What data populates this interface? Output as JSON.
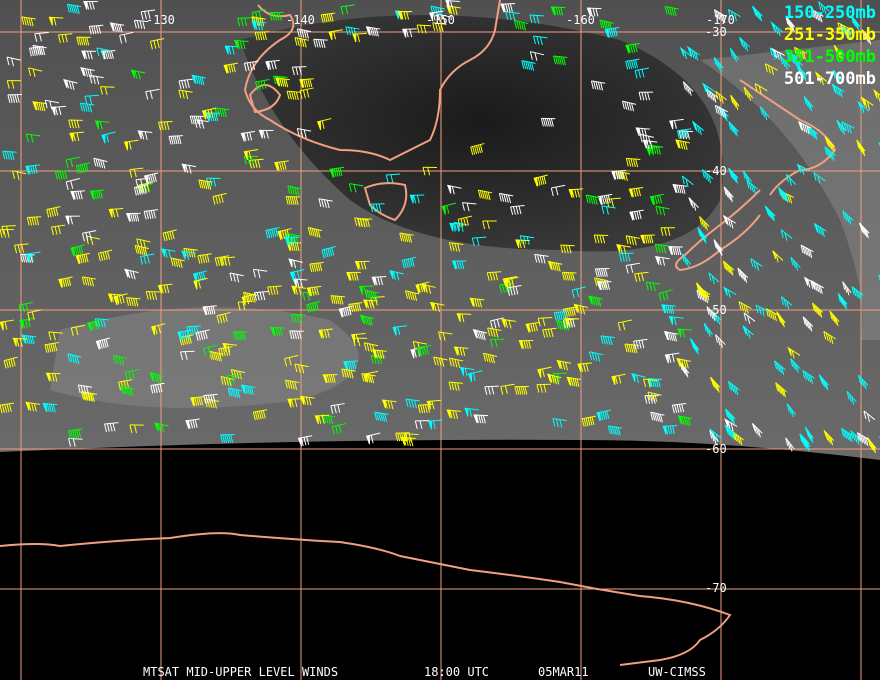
{
  "map": {
    "lon_labels": [
      "-130",
      "-140",
      "-150",
      "-160",
      "-170"
    ],
    "lat_labels": [
      "-30",
      "-40",
      "-50",
      "-60",
      "-70"
    ],
    "grid_color": "#f0a080",
    "coast_color": "#f0a080"
  },
  "legend": [
    {
      "label": "150-250mb",
      "color": "#00ffff"
    },
    {
      "label": "251-350mb",
      "color": "#ffff00"
    },
    {
      "label": "351-500mb",
      "color": "#00ff00"
    },
    {
      "label": "501-700mb",
      "color": "#ffffff"
    }
  ],
  "footer": {
    "product": "MTSAT MID-UPPER LEVEL WINDS",
    "time": "18:00 UTC",
    "date": "05MAR11",
    "source": "UW-CIMSS"
  }
}
